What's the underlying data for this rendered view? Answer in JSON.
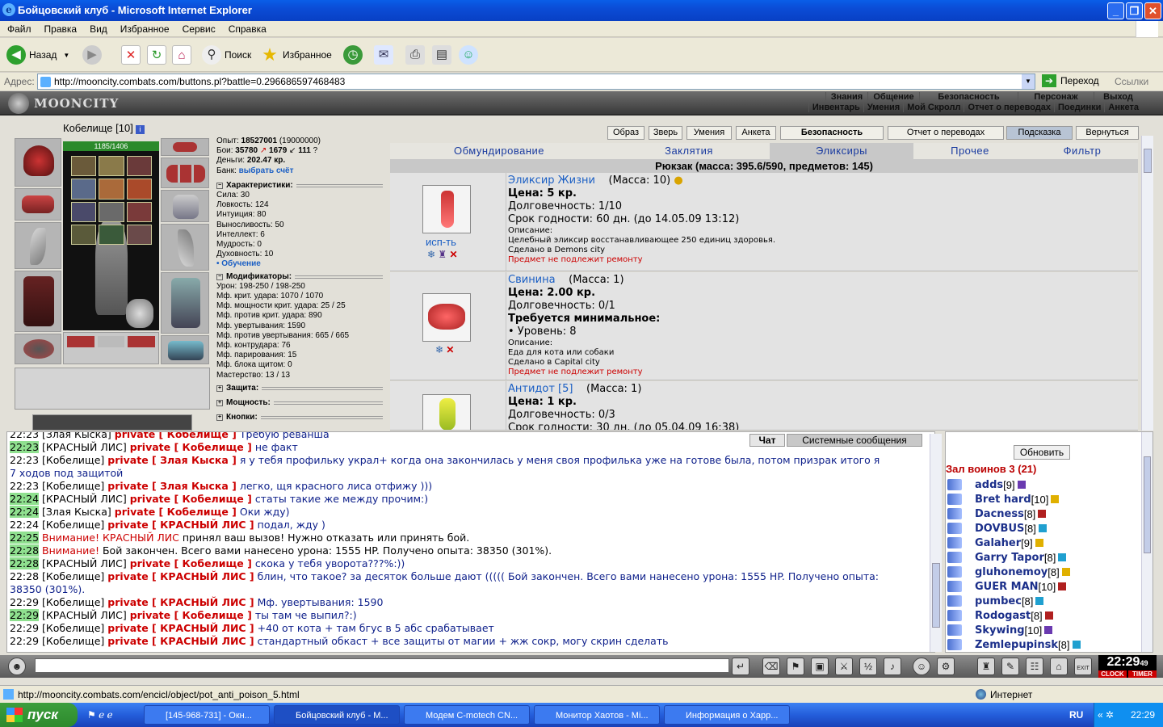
{
  "window": {
    "title": "Бойцовский клуб - Microsoft Internet Explorer"
  },
  "menu": [
    "Файл",
    "Правка",
    "Вид",
    "Избранное",
    "Сервис",
    "Справка"
  ],
  "toolbar": {
    "back": "Назад",
    "search": "Поиск",
    "favorites": "Избранное"
  },
  "address": {
    "label": "Адрес:",
    "url": "http://mooncity.combats.com/buttons.pl?battle=0.296686597468483",
    "go": "Переход",
    "links": "Ссылки"
  },
  "game": {
    "logo": "MOONCITY",
    "toplinks1": [
      "Знания",
      "Общение",
      "Безопасность",
      "Персонаж",
      "Выход"
    ],
    "toplinks2": [
      "Инвентарь",
      "Умения",
      "Мой Скролл",
      "Отчет о переводах",
      "Поединки",
      "Анкета"
    ],
    "character": {
      "name": "Кобелище [10]",
      "hp": "1185/1406"
    },
    "stats_top": {
      "exp_label": "Опыт:",
      "exp": "18527001",
      "exp_next": "(19000000)",
      "fights_label": "Бои:",
      "wins": "35780",
      "losses": "1679",
      "draws": "111",
      "money_label": "Деньги:",
      "money": "202.47 кр.",
      "bank_label": "Банк:",
      "bank": "выбрать счёт"
    },
    "characteristics": {
      "title": "Характеристики:",
      "items": [
        "Сила: 30",
        "Ловкость: 124",
        "Интуиция: 80",
        "Выносливость: 50",
        "Интеллект: 6",
        "Мудрость: 0",
        "Духовность: 10"
      ],
      "training": "• Обучение"
    },
    "modifiers": {
      "title": "Модификаторы:",
      "items": [
        "Урон: 198-250 / 198-250",
        "Мф. крит. удара: 1070 / 1070",
        "Мф. мощности крит. удара: 25 / 25",
        "Мф. против крит. удара: 890",
        "Мф. увертывания: 1590",
        "Мф. против увертывания: 665 / 665",
        "Мф. контрудара: 76",
        "Мф. парирования: 15",
        "Мф. блока щитом: 0",
        "Мастерство: 13 / 13"
      ]
    },
    "collapsed": [
      "Защита:",
      "Мощность:",
      "Кнопки:"
    ],
    "buttons": [
      "Образ",
      "Зверь",
      "Умения",
      "Анкета",
      "Безопасность",
      "Отчет о переводах",
      "Подсказка",
      "Вернуться"
    ],
    "navtabs": [
      "Обмундирование",
      "Заклятия",
      "Эликсиры",
      "Прочее",
      "Фильтр"
    ],
    "backpack": "Рюкзак (масса: 395.6/590, предметов: 145)",
    "items": [
      {
        "name": "Эликсир Жизни",
        "mass": "(Масса: 10)",
        "price": "Цена: 5 кр.",
        "dur": "Долговечность: 1/10",
        "expiry": "Срок годности: 60 дн. (до 14.05.09 13:12)",
        "desc_label": "Описание:",
        "desc": "Целебный эликсир восстанавливающее 250 единиц здоровья.",
        "made": "Сделано в Demons city",
        "norepair": "Предмет не подлежит ремонту",
        "use": "исп-ть"
      },
      {
        "name": "Свинина",
        "mass": "(Масса: 1)",
        "price": "Цена: 2.00 кр.",
        "dur": "Долговечность: 0/1",
        "req": "Требуется минимальное:",
        "level": "• Уровень: 8",
        "desc_label": "Описание:",
        "desc": "Еда для кота или собаки",
        "made": "Сделано в Capital city",
        "norepair": "Предмет не подлежит ремонту"
      },
      {
        "name": "Антидот [5]",
        "mass": "(Масса: 1)",
        "price": "Цена: 1 кр.",
        "dur": "Долговечность: 0/3",
        "expiry": "Срок годности: 30 дн. (до 05.04.09 16:38)"
      }
    ]
  },
  "chat": {
    "tabs": [
      "Чат",
      "Системные сообщения"
    ],
    "lines": [
      {
        "t": "22:23",
        "g": false,
        "nick": "[Злая Кыска]",
        "priv": "private [ Кобелище ]",
        "msg": "Требую реванша"
      },
      {
        "t": "22:23",
        "g": true,
        "nick": "[КРАСНЫЙ ЛИС]",
        "priv": "private [ Кобелище ]",
        "msg": "не факт"
      },
      {
        "t": "22:23",
        "g": false,
        "nick": "[Кобелище]",
        "priv": "private [ Злая Кыска ]",
        "msg": "я у тебя профильку украл+ когда она закончилась у меня своя профилька уже на готове была, потом призрак итого я"
      },
      {
        "t": "",
        "g": false,
        "nick": "",
        "priv": "",
        "msg": "7 ходов под защитой"
      },
      {
        "t": "22:23",
        "g": false,
        "nick": "[Кобелище]",
        "priv": "private [ Злая Кыска ]",
        "msg": "легко, щя красного лиса отфижу )))"
      },
      {
        "t": "22:24",
        "g": true,
        "nick": "[КРАСНЫЙ ЛИС]",
        "priv": "private [ Кобелище ]",
        "msg": "статы такие же между прочим:)"
      },
      {
        "t": "22:24",
        "g": true,
        "nick": "[Злая Кыска]",
        "priv": "private [ Кобелище ]",
        "msg": "Оки жду)"
      },
      {
        "t": "22:24",
        "g": false,
        "nick": "[Кобелище]",
        "priv": "private [ КРАСНЫЙ ЛИС ]",
        "msg": "подал, жду )"
      },
      {
        "t": "22:25",
        "g": true,
        "warn": "Внимание!",
        "nick": "КРАСНЫЙ ЛИС",
        "priv": "",
        "msg": "принял ваш вызов! Нужно отказать или принять бой."
      },
      {
        "t": "22:28",
        "g": true,
        "warn": "Внимание!",
        "nick": "",
        "priv": "",
        "msg": "Бой закончен. Всего вами нанесено урона: 1555 HP. Получено опыта: 38350 (301%)."
      },
      {
        "t": "22:28",
        "g": true,
        "nick": "[КРАСНЫЙ ЛИС]",
        "priv": "private [ Кобелище ]",
        "msg": "скока у тебя уворота???%:))"
      },
      {
        "t": "22:28",
        "g": false,
        "nick": "[Кобелище]",
        "priv": "private [ КРАСНЫЙ ЛИС ]",
        "msg": "блин, что такое? за десяток больше дают ((((( Бой закончен. Всего вами нанесено урона: 1555 HP. Получено опыта:"
      },
      {
        "t": "",
        "g": false,
        "nick": "",
        "priv": "",
        "msg": "38350 (301%)."
      },
      {
        "t": "22:29",
        "g": false,
        "nick": "[Кобелище]",
        "priv": "private [ КРАСНЫЙ ЛИС ]",
        "msg": "Мф. увертывания: 1590"
      },
      {
        "t": "22:29",
        "g": true,
        "nick": "[КРАСНЫЙ ЛИС]",
        "priv": "private [ Кобелище ]",
        "msg": "ты там че выпил?:)"
      },
      {
        "t": "22:29",
        "g": false,
        "nick": "[Кобелище]",
        "priv": "private [ КРАСНЫЙ ЛИС ]",
        "msg": "+40 от кота + там бгус в 5 абс срабатывает"
      },
      {
        "t": "22:29",
        "g": false,
        "nick": "[Кобелище]",
        "priv": "private [ КРАСНЫЙ ЛИС ]",
        "msg": "стандартный обкаст + все защиты от магии + жж сокр, могу скрин сделать"
      }
    ]
  },
  "users": {
    "refresh": "Обновить",
    "room": "Зал воинов 3 (21)",
    "list": [
      {
        "name": "adds",
        "lvl": "[9]"
      },
      {
        "name": "Bret hard",
        "lvl": "[10]"
      },
      {
        "name": "Dacness",
        "lvl": "[8]"
      },
      {
        "name": "DOVBUS",
        "lvl": "[8]"
      },
      {
        "name": "Galaher",
        "lvl": "[9]"
      },
      {
        "name": "Garry Tapor",
        "lvl": "[8]"
      },
      {
        "name": "gluhonemoy",
        "lvl": "[8]"
      },
      {
        "name": "GUER MAN",
        "lvl": "[10]"
      },
      {
        "name": "pumbec",
        "lvl": "[8]"
      },
      {
        "name": "Rodogast",
        "lvl": "[8]"
      },
      {
        "name": "Skywing",
        "lvl": "[10]"
      },
      {
        "name": "Zemlepupinsk",
        "lvl": "[8]"
      }
    ]
  },
  "clock": {
    "time": "22:29",
    "sec": "49",
    "label1": "CLOCK",
    "label2": "TIMER",
    "exit": "EXIT"
  },
  "statusbar": {
    "url": "http://mooncity.combats.com/encicl/object/pot_anti_poison_5.html",
    "zone": "Интернет"
  },
  "taskbar": {
    "start": "пуск",
    "tasks": [
      "[145-968-731] - Окн...",
      "Бойцовский клуб - M...",
      "Модем C-motech CN...",
      "Монитор Хаотов - Mi...",
      "Информация о Харр..."
    ],
    "lang": "RU",
    "time": "22:29"
  },
  "colors": {
    "xp_blue": "#0a5ee8",
    "chat_private": "#cc0000",
    "chat_msg": "#0d1f8a",
    "link": "#1b5fc4"
  }
}
